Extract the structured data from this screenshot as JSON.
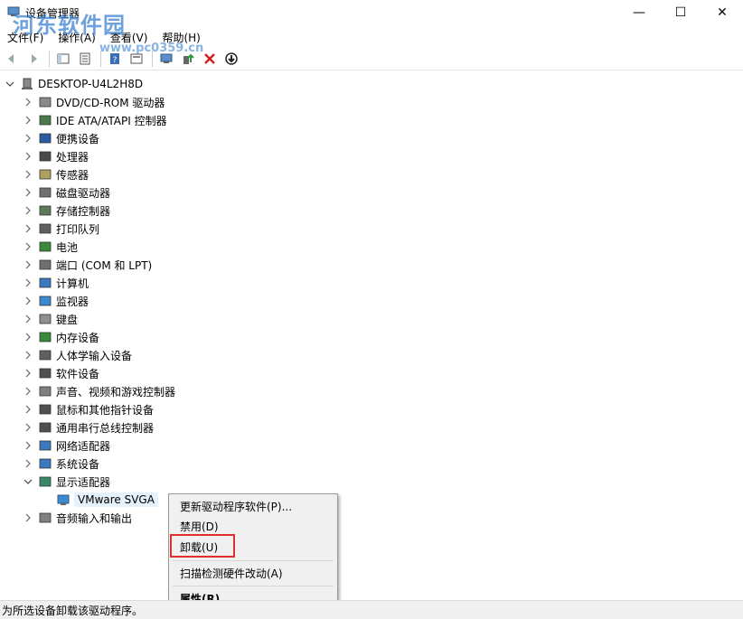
{
  "window": {
    "title": "设备管理器",
    "minimize_glyph": "—",
    "maximize_glyph": "☐",
    "close_glyph": "✕"
  },
  "watermark": {
    "text": "河东软件园",
    "url": "www.pc0359.cn"
  },
  "menu": [
    {
      "label": "文件(F)"
    },
    {
      "label": "操作(A)"
    },
    {
      "label": "查看(V)"
    },
    {
      "label": "帮助(H)"
    }
  ],
  "toolbar": {
    "icons": [
      "back-arrow-icon",
      "forward-arrow-icon",
      "show-hide-tree-icon",
      "properties-icon",
      "help-icon",
      "view-icon",
      "scan-monitor-icon",
      "update-driver-icon",
      "uninstall-x-icon",
      "download-icon"
    ]
  },
  "tree": {
    "root": "DESKTOP-U4L2H8D",
    "categories": [
      {
        "label": "DVD/CD-ROM 驱动器"
      },
      {
        "label": "IDE ATA/ATAPI 控制器"
      },
      {
        "label": "便携设备"
      },
      {
        "label": "处理器"
      },
      {
        "label": "传感器"
      },
      {
        "label": "磁盘驱动器"
      },
      {
        "label": "存储控制器"
      },
      {
        "label": "打印队列"
      },
      {
        "label": "电池"
      },
      {
        "label": "端口 (COM 和 LPT)"
      },
      {
        "label": "计算机"
      },
      {
        "label": "监视器"
      },
      {
        "label": "键盘"
      },
      {
        "label": "内存设备"
      },
      {
        "label": "人体学输入设备"
      },
      {
        "label": "软件设备"
      },
      {
        "label": "声音、视频和游戏控制器"
      },
      {
        "label": "鼠标和其他指针设备"
      },
      {
        "label": "通用串行总线控制器"
      },
      {
        "label": "网络适配器"
      },
      {
        "label": "系统设备"
      },
      {
        "label": "显示适配器"
      },
      {
        "label": "音频输入和输出"
      }
    ],
    "display_child": "VMware SVGA"
  },
  "context_menu": {
    "update_driver": "更新驱动程序软件(P)...",
    "disable": "禁用(D)",
    "uninstall": "卸载(U)",
    "scan": "扫描检测硬件改动(A)",
    "properties": "属性(R)"
  },
  "status": {
    "text": "为所选设备卸载该驱动程序。"
  },
  "colors": {
    "highlight_box": "#e0302d",
    "selection": "#e5f1fb",
    "watermark": "#3c82d2"
  }
}
